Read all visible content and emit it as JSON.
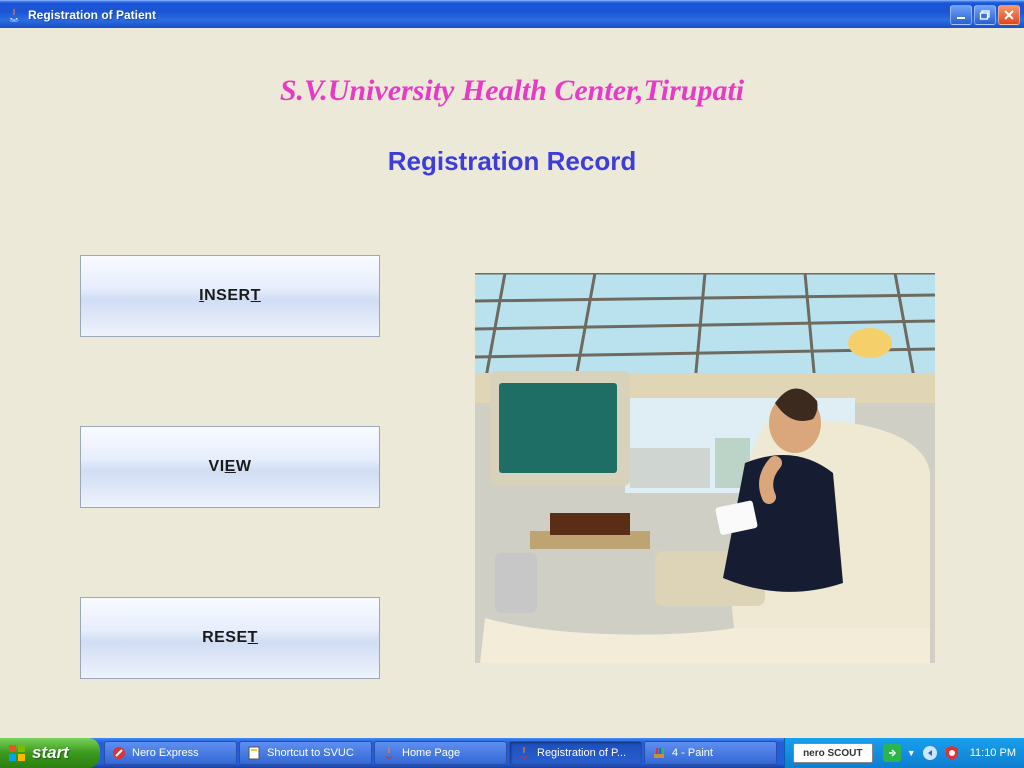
{
  "window": {
    "title": "Registration of Patient"
  },
  "page": {
    "heading": "S.V.University Health Center,Tirupati",
    "subheading": "Registration Record"
  },
  "buttons": {
    "insert_label": "INSERT",
    "view_label": "VIEW",
    "reset_label": "RESET"
  },
  "taskbar": {
    "start_label": "start",
    "items": [
      {
        "label": "Nero Express"
      },
      {
        "label": "Shortcut to SVUC"
      },
      {
        "label": "Home Page"
      },
      {
        "label": "Registration of P..."
      },
      {
        "label": "4 - Paint"
      }
    ],
    "nero_label": "nero SCOUT",
    "clock": "11:10 PM"
  }
}
